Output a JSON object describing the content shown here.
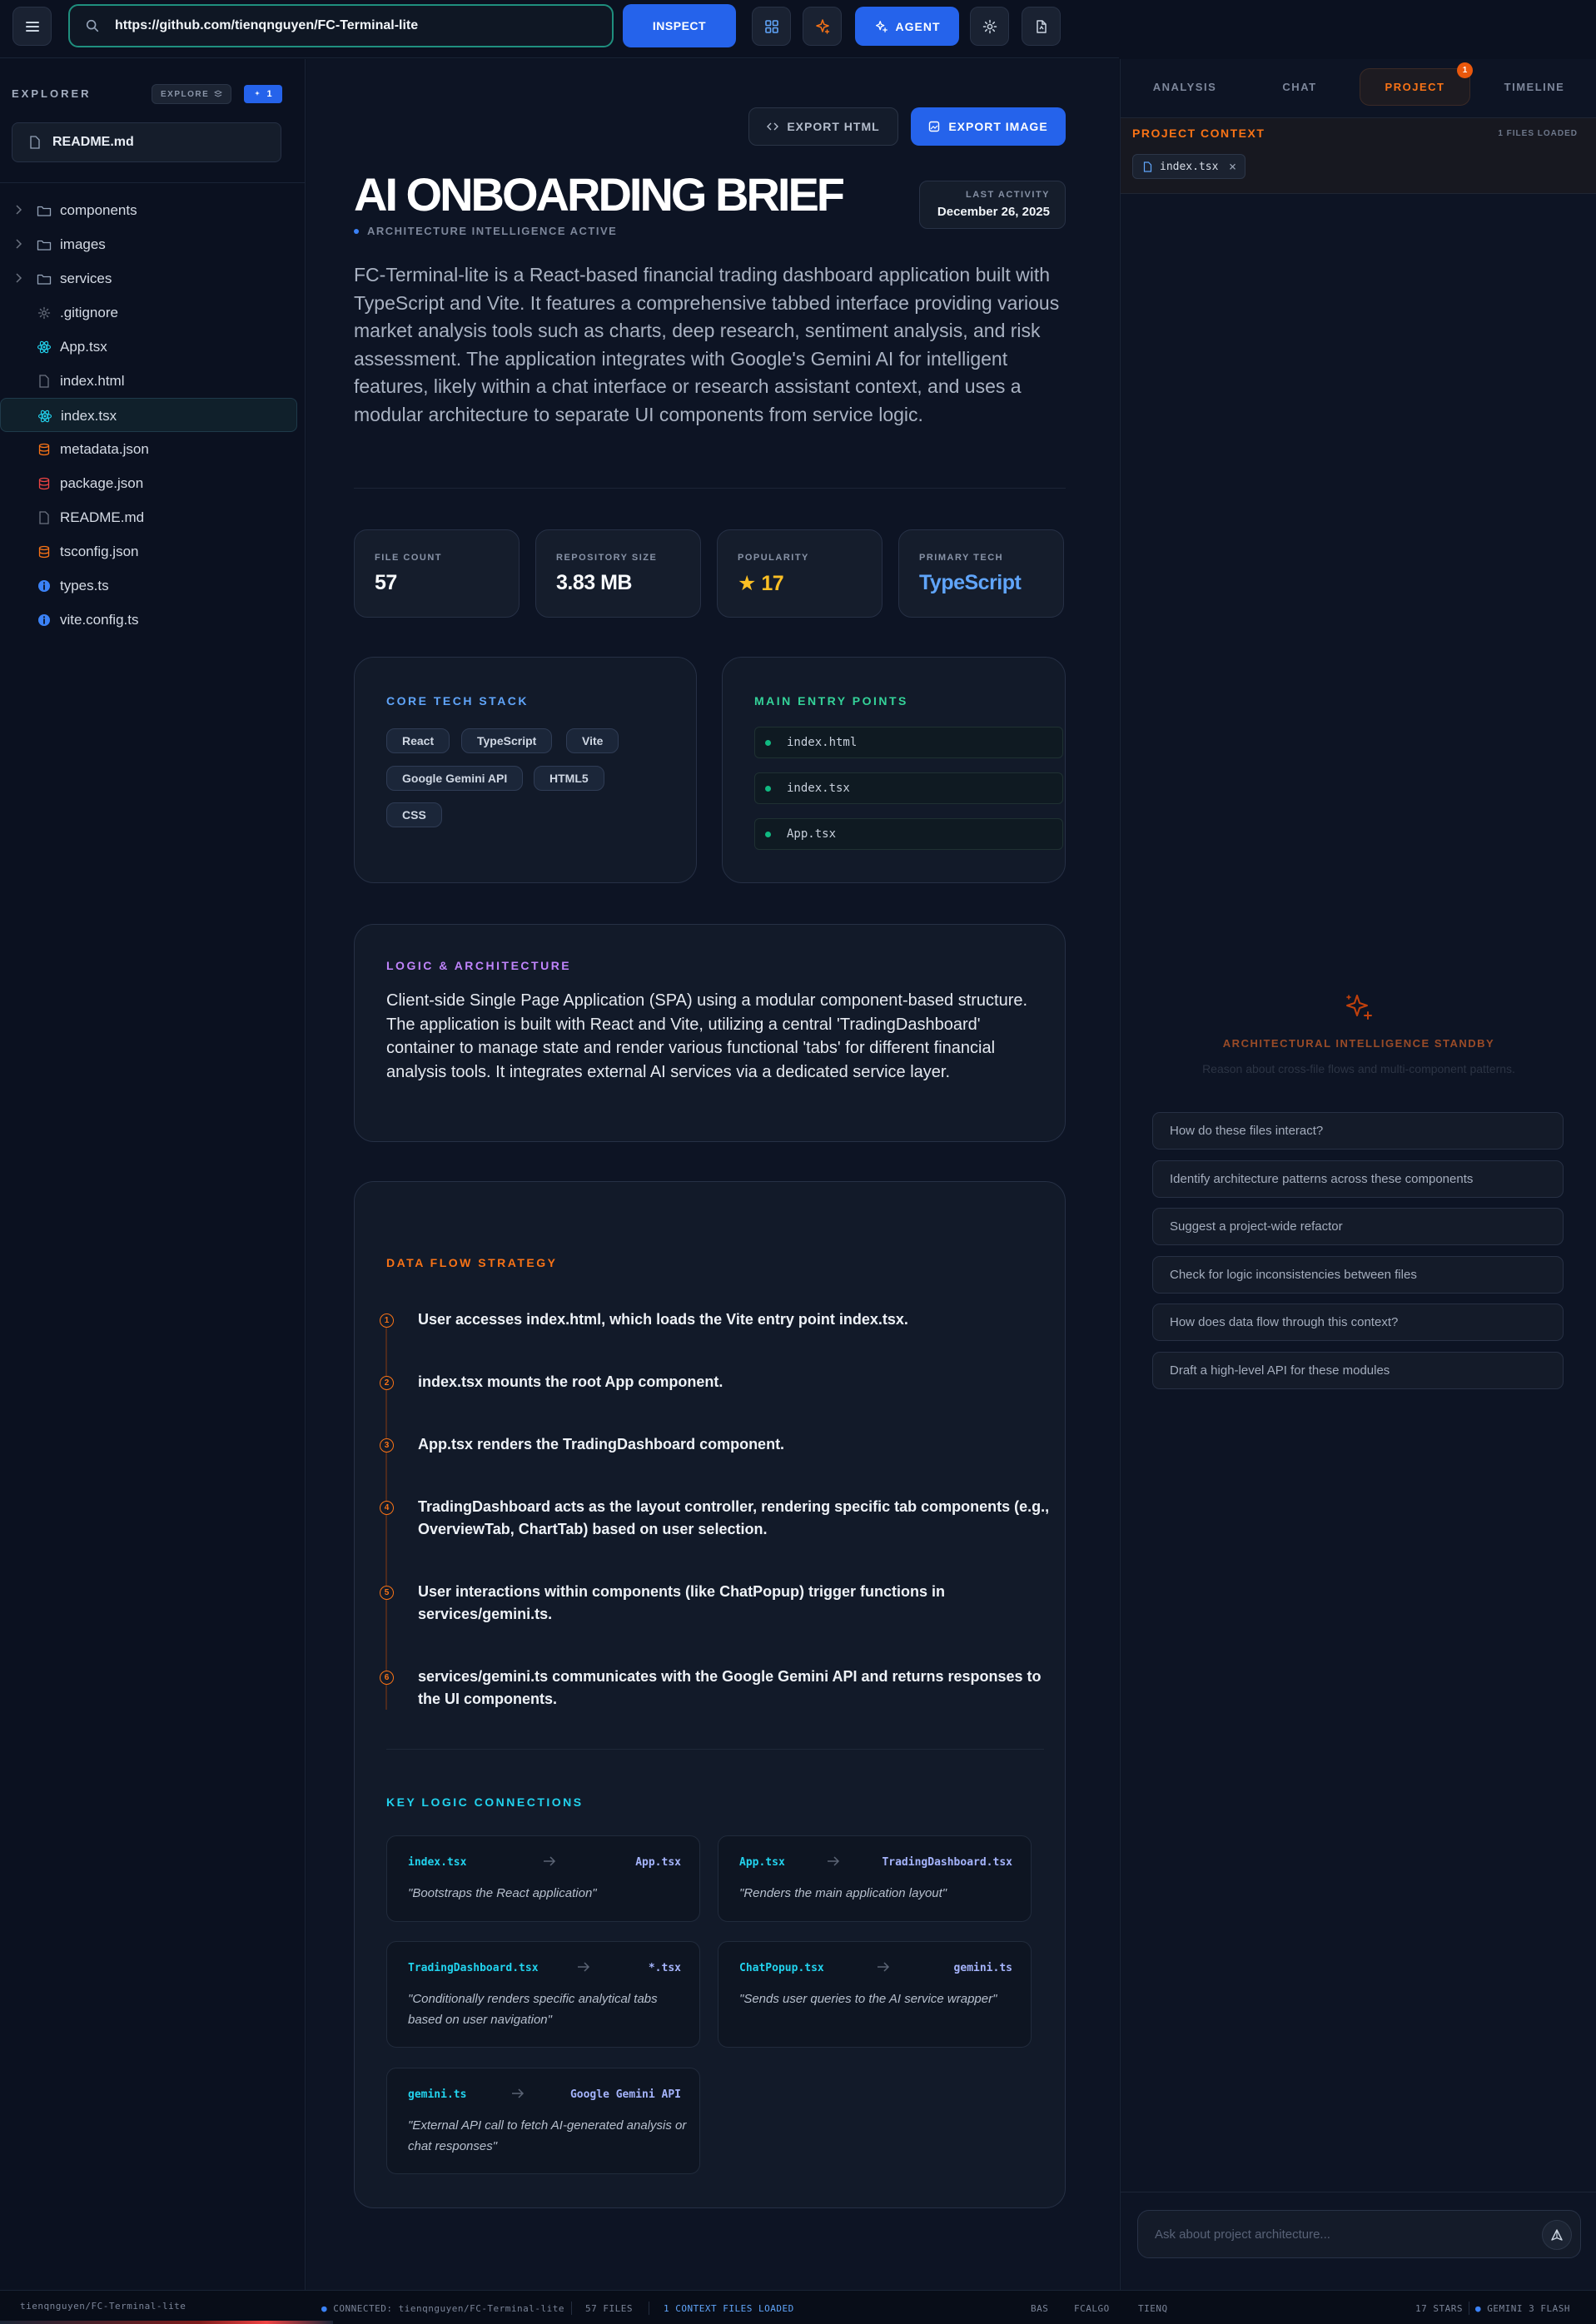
{
  "toolbar": {
    "url_value": "https://github.com/tienqnguyen/FC-Terminal-lite",
    "inspect_label": "INSPECT",
    "agent_label": "AGENT"
  },
  "sidebar": {
    "title": "EXPLORER",
    "explore_label": "EXPLORE",
    "badge_count": "1",
    "open_file": "README.md",
    "items": [
      {
        "label": "components",
        "type": "folder",
        "icon": "folder-icon"
      },
      {
        "label": "images",
        "type": "folder",
        "icon": "folder-icon"
      },
      {
        "label": "services",
        "type": "folder",
        "icon": "folder-icon"
      },
      {
        "label": ".gitignore",
        "type": "file",
        "icon": "gear-icon",
        "color": "#6b7280"
      },
      {
        "label": "App.tsx",
        "type": "file",
        "icon": "react-icon",
        "color": "#22d3ee"
      },
      {
        "label": "index.html",
        "type": "file",
        "icon": "file-icon",
        "color": "#6b7280"
      },
      {
        "label": "index.tsx",
        "type": "file",
        "icon": "react-icon",
        "color": "#22d3ee",
        "active": true
      },
      {
        "label": "metadata.json",
        "type": "file",
        "icon": "database-icon",
        "color": "#f97316"
      },
      {
        "label": "package.json",
        "type": "file",
        "icon": "database-icon",
        "color": "#ef4444"
      },
      {
        "label": "README.md",
        "type": "file",
        "icon": "file-icon",
        "color": "#6b7280"
      },
      {
        "label": "tsconfig.json",
        "type": "file",
        "icon": "database-icon",
        "color": "#f97316"
      },
      {
        "label": "types.ts",
        "type": "file",
        "icon": "info-icon",
        "color": "#3b82f6"
      },
      {
        "label": "vite.config.ts",
        "type": "file",
        "icon": "info-icon",
        "color": "#3b82f6"
      }
    ]
  },
  "main": {
    "export_html_label": "EXPORT HTML",
    "export_image_label": "EXPORT IMAGE",
    "title": "AI ONBOARDING BRIEF",
    "subtitle": "ARCHITECTURE INTELLIGENCE ACTIVE",
    "last_activity_label": "LAST ACTIVITY",
    "last_activity_value": "December 26, 2025",
    "summary": "FC-Terminal-lite is a React-based financial trading dashboard application built with TypeScript and Vite. It features a comprehensive tabbed interface providing various market analysis tools such as charts, deep research, sentiment analysis, and risk assessment. The application integrates with Google's Gemini AI for intelligent features, likely within a chat interface or research assistant context, and uses a modular architecture to separate UI components from service logic.",
    "stats": [
      {
        "label": "FILE COUNT",
        "value": "57",
        "color": "#f8fafc"
      },
      {
        "label": "REPOSITORY SIZE",
        "value": "3.83 MB",
        "color": "#f8fafc"
      },
      {
        "label": "POPULARITY",
        "value": "★ 17",
        "color": "#fbbf24"
      },
      {
        "label": "PRIMARY TECH",
        "value": "TypeScript",
        "color": "#60a5fa"
      }
    ],
    "tech_stack": {
      "title": "CORE TECH STACK",
      "items": [
        "React",
        "TypeScript",
        "Vite",
        "Google Gemini API",
        "HTML5",
        "CSS"
      ]
    },
    "entry_points": {
      "title": "MAIN ENTRY POINTS",
      "items": [
        "index.html",
        "index.tsx",
        "App.tsx"
      ]
    },
    "logic": {
      "title": "LOGIC & ARCHITECTURE",
      "text": "Client-side Single Page Application (SPA) using a modular component-based structure. The application is built with React and Vite, utilizing a central 'TradingDashboard' container to manage state and render various functional 'tabs' for different financial analysis tools. It integrates external AI services via a dedicated service layer."
    },
    "data_flow": {
      "title": "DATA FLOW STRATEGY",
      "steps": [
        {
          "num": "1",
          "text": "User accesses index.html, which loads the Vite entry point index.tsx."
        },
        {
          "num": "2",
          "text": "index.tsx mounts the root App component."
        },
        {
          "num": "3",
          "text": "App.tsx renders the TradingDashboard component."
        },
        {
          "num": "4",
          "text": "TradingDashboard acts as the layout controller, rendering specific tab components (e.g., OverviewTab, ChartTab) based on user selection."
        },
        {
          "num": "5",
          "text": "User interactions within components (like ChatPopup) trigger functions in services/gemini.ts."
        },
        {
          "num": "6",
          "text": "services/gemini.ts communicates with the Google Gemini API and returns responses to the UI components."
        }
      ]
    },
    "connections": {
      "title": "KEY LOGIC CONNECTIONS",
      "items": [
        {
          "from": "index.tsx",
          "to": "App.tsx",
          "desc": "\"Bootstraps the React application\""
        },
        {
          "from": "App.tsx",
          "to": "TradingDashboard.tsx",
          "desc": "\"Renders the main application layout\""
        },
        {
          "from": "TradingDashboard.tsx",
          "to": "*.tsx",
          "desc": "\"Conditionally renders specific analytical tabs based on user navigation\""
        },
        {
          "from": "ChatPopup.tsx",
          "to": "gemini.ts",
          "desc": "\"Sends user queries to the AI service wrapper\""
        },
        {
          "from": "gemini.ts",
          "to": "Google Gemini API",
          "desc": "\"External API call to fetch AI-generated analysis or chat responses\""
        }
      ]
    }
  },
  "rpanel": {
    "tabs": [
      {
        "label": "ANALYSIS"
      },
      {
        "label": "CHAT"
      },
      {
        "label": "PROJECT",
        "active": true,
        "badge": "1"
      },
      {
        "label": "TIMELINE"
      }
    ],
    "context_title": "PROJECT CONTEXT",
    "context_count": "1 FILES LOADED",
    "context_file": "index.tsx",
    "standby_title": "ARCHITECTURAL INTELLIGENCE STANDBY",
    "standby_sub": "Reason about cross-file flows and multi-component patterns.",
    "suggestions": [
      "How do these files interact?",
      "Identify architecture patterns across these components",
      "Suggest a project-wide refactor",
      "Check for logic inconsistencies between files",
      "How does data flow through this context?",
      "Draft a high-level API for these modules"
    ],
    "ask_placeholder": "Ask about project architecture..."
  },
  "statusbar": {
    "repo": "tienqnguyen/FC-Terminal-lite",
    "connected": "CONNECTED: tienqnguyen/FC-Terminal-lite",
    "files": "57 FILES",
    "context": "1 CONTEXT FILES LOADED",
    "tickers": [
      "BAS",
      "FCALGO",
      "TIENQ"
    ],
    "stars": "17 STARS",
    "model": "GEMINI 3 FLASH"
  },
  "colors": {
    "accent_blue": "#2563eb",
    "accent_orange": "#f97316",
    "accent_green": "#10b981",
    "accent_purple": "#c084fc",
    "accent_cyan": "#22d3ee"
  }
}
